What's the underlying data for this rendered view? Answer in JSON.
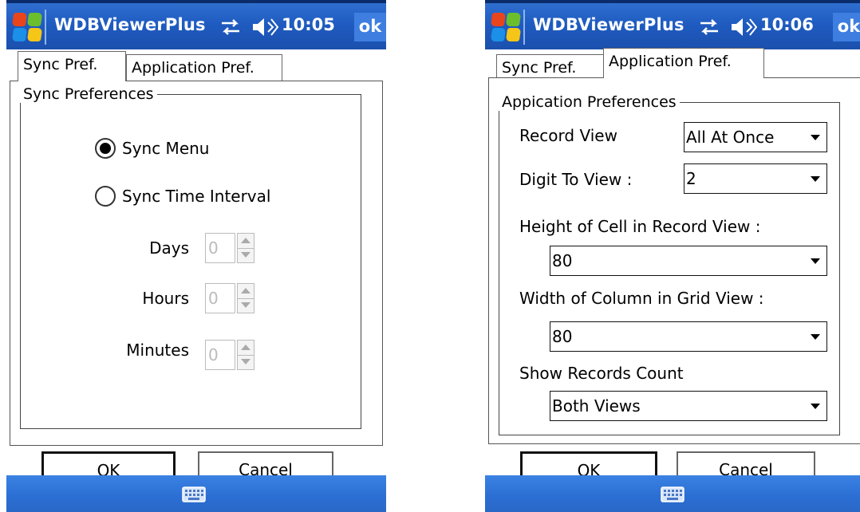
{
  "screens": [
    {
      "title": "WDBViewerPlus",
      "clock": "10:05",
      "ok_label": "ok",
      "tabs": [
        "Sync Pref.",
        "Application Pref."
      ],
      "active_tab": "Sync Pref.",
      "group_title": "Sync Preferences",
      "radios": [
        {
          "label": "Sync Menu",
          "checked": true
        },
        {
          "label": "Sync Time Interval",
          "checked": false
        }
      ],
      "spins": [
        {
          "label": "Days",
          "value": "0"
        },
        {
          "label": "Hours",
          "value": "0"
        },
        {
          "label": "Minutes",
          "value": "0"
        }
      ],
      "buttons": {
        "ok": "OK",
        "cancel": "Cancel"
      }
    },
    {
      "title": "WDBViewerPlus",
      "clock": "10:06",
      "ok_label": "ok",
      "tabs": [
        "Sync Pref.",
        "Application Pref."
      ],
      "active_tab": "Application Pref.",
      "group_title": "Appication Preferences",
      "fields": [
        {
          "label": "Record View",
          "value": "All At Once"
        },
        {
          "label": "Digit To View :",
          "value": "2"
        },
        {
          "label": "Height of Cell in Record View :",
          "value": "80"
        },
        {
          "label": "Width of Column in Grid View :",
          "value": "80"
        },
        {
          "label": "Show Records Count",
          "value": "Both Views"
        }
      ],
      "buttons": {
        "ok": "OK",
        "cancel": "Cancel"
      }
    }
  ],
  "icons": {
    "start": "windows-flag-icon",
    "connectivity": "connectivity-arrows-icon",
    "volume": "speaker-volume-icon",
    "keyboard": "keyboard-icon"
  },
  "colors": {
    "titlebar": "#1f5bc0",
    "bottombar": "#2b6ed3",
    "ok_button": "#3d7ee0"
  }
}
